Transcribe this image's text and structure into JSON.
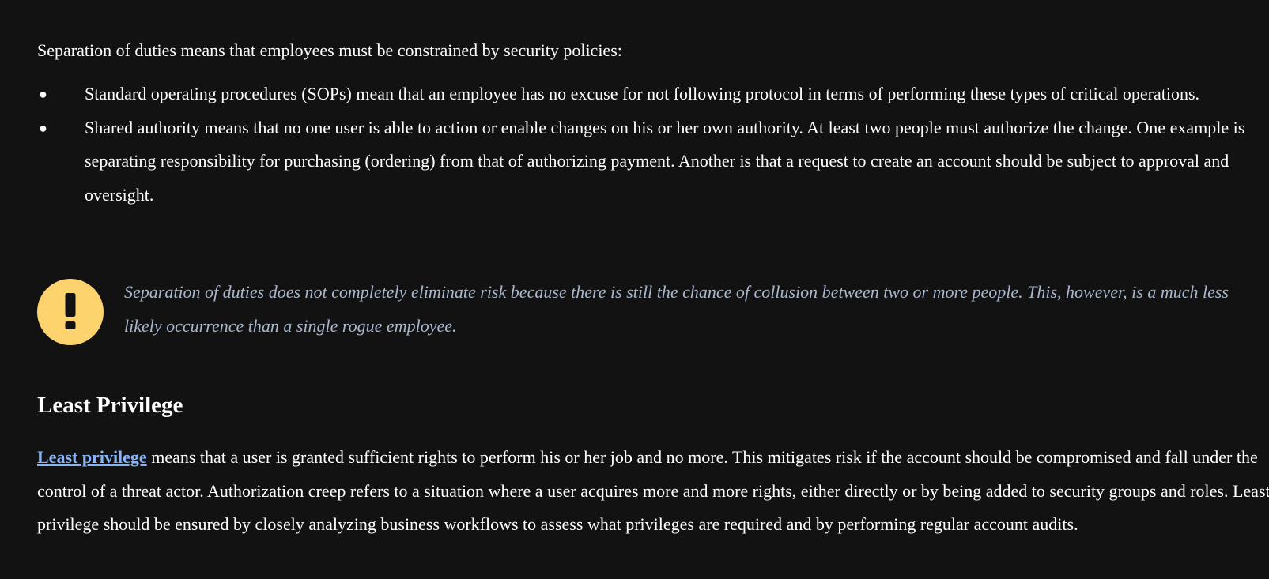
{
  "intro": "Separation of duties means that employees must be constrained by security policies:",
  "bullets": [
    {
      "text": "Standard operating procedures (SOPs) mean that an employee has no excuse for not following protocol in terms of performing these types of critical operations."
    },
    {
      "text": "Shared authority means that no one user is able to action or enable changes on his or her own authority. At least two people must authorize the change. One example is separating responsibility for purchasing (ordering) from that of authorizing payment. Another is that a request to create an account should be subject to approval and oversight."
    }
  ],
  "bullet_symbol": "●",
  "note": {
    "icon": "exclamation-icon",
    "icon_color": "#fdd36e",
    "text": "Separation of duties does not completely eliminate risk because there is still the chance of collusion between two or more people. This, however, is a much less likely occurrence than a single rogue employee."
  },
  "section": {
    "heading": "Least Privilege",
    "link_text": "Least privilege",
    "paragraph_rest": " means that a user is granted sufficient rights to perform his or her job and no more. This mitigates risk if the account should be compromised and fall under the control of a threat actor. Authorization creep refers to a situation where a user acquires more and more rights, either directly or by being added to security groups and roles. Least privilege should be ensured by closely analyzing business workflows to assess what privileges are required and by performing regular account audits."
  },
  "colors": {
    "background": "#121212",
    "text": "#ffffff",
    "note_text": "#a9b8cf",
    "link": "#8ab4f8"
  }
}
